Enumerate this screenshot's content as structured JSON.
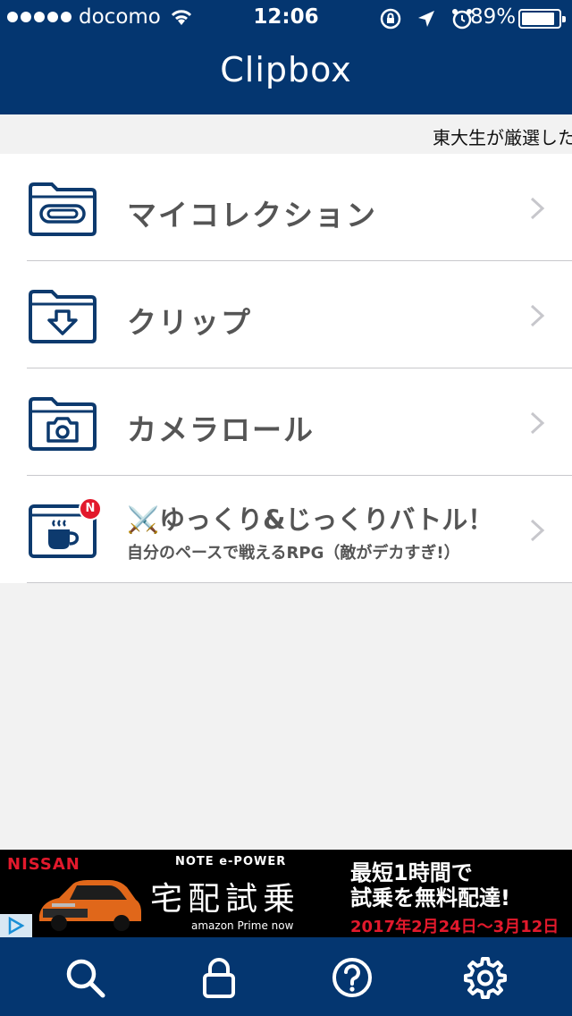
{
  "status_bar": {
    "carrier": "docomo",
    "time": "12:06",
    "battery": "89%",
    "battery_level": 0.89
  },
  "nav": {
    "title": "Clipbox"
  },
  "ticker": {
    "text": "東大生が厳選した、"
  },
  "list": {
    "items": [
      {
        "label": "マイコレクション",
        "icon": "folder-clip-icon"
      },
      {
        "label": "クリップ",
        "icon": "folder-download-icon"
      },
      {
        "label": "カメラロール",
        "icon": "folder-camera-icon"
      },
      {
        "label": "⚔️ゆっくり&じっくりバトル！",
        "sublabel": "自分のペースで戦えるRPG（敵がデカすぎ!）",
        "icon": "coffee-cup-icon",
        "badge": "N"
      }
    ]
  },
  "ad": {
    "brand": "NISSAN",
    "model": "NOTE e-POWER",
    "headline": "宅配試乗",
    "partner": "amazon Prime now",
    "copy_line1": "最短1時間で",
    "copy_line2": "試乗を無料配達!",
    "date": "2017年2月24日～3月12日"
  },
  "tabbar": {
    "items": [
      {
        "icon": "search-icon"
      },
      {
        "icon": "lock-icon"
      },
      {
        "icon": "help-icon"
      },
      {
        "icon": "gear-icon"
      }
    ]
  },
  "colors": {
    "nav": "#043670",
    "icon": "#0d3a6e",
    "badge": "#e2192c",
    "ad_accent": "#e2192c"
  }
}
